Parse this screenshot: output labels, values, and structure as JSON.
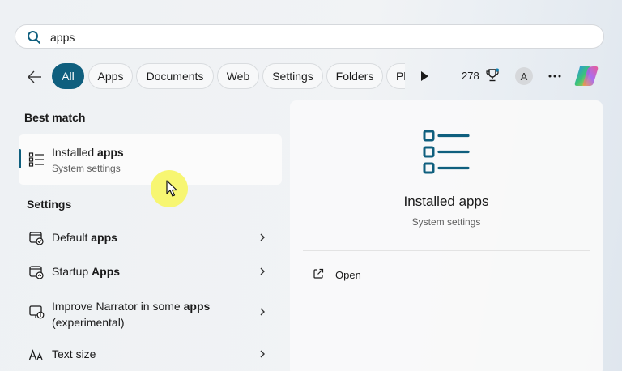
{
  "search": {
    "value": "apps",
    "icon": "search-icon"
  },
  "filters": {
    "chips": [
      {
        "label": "All",
        "active": true
      },
      {
        "label": "Apps"
      },
      {
        "label": "Documents"
      },
      {
        "label": "Web"
      },
      {
        "label": "Settings"
      },
      {
        "label": "Folders"
      },
      {
        "label": "Ph"
      }
    ],
    "points": "278",
    "avatar_initial": "A",
    "accent_color": "#0f5f7e"
  },
  "best_match": {
    "heading": "Best match",
    "item": {
      "title_pre": "Installed ",
      "title_bold": "apps",
      "subtitle": "System settings"
    }
  },
  "settings": {
    "heading": "Settings",
    "items": [
      {
        "pre": "Default ",
        "bold": "apps",
        "post": "",
        "line2": ""
      },
      {
        "pre": "Startup ",
        "bold": "Apps",
        "post": "",
        "line2": ""
      },
      {
        "pre": "Improve Narrator in some ",
        "bold": "apps",
        "post": "",
        "line2": "(experimental)"
      },
      {
        "pre": "Text size",
        "bold": "",
        "post": "",
        "line2": ""
      }
    ]
  },
  "preview": {
    "title": "Installed apps",
    "subtitle": "System settings",
    "actions": [
      {
        "label": "Open"
      }
    ]
  }
}
